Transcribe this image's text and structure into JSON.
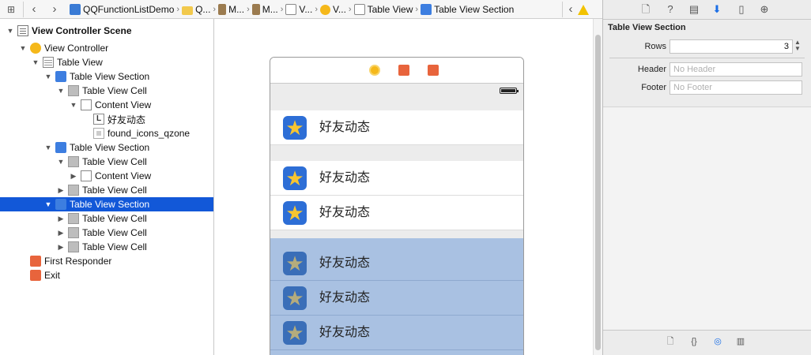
{
  "breadcrumbs": [
    {
      "label": "QQFunctionListDemo",
      "icon": "project-icon"
    },
    {
      "label": "Q...",
      "icon": "folder-icon"
    },
    {
      "label": "M...",
      "icon": "file-icon"
    },
    {
      "label": "M...",
      "icon": "file-icon"
    },
    {
      "label": "V...",
      "icon": "view-controller-scene-icon"
    },
    {
      "label": "V...",
      "icon": "view-controller-icon"
    },
    {
      "label": "Table View",
      "icon": "table-view-icon"
    },
    {
      "label": "Table View Section",
      "icon": "table-view-section-icon"
    }
  ],
  "outline": {
    "items": [
      {
        "label": "View Controller Scene",
        "level": 0,
        "disclosure": "open",
        "icon": "scene-icon",
        "bold": true
      },
      {
        "label": "View Controller",
        "level": 1,
        "disclosure": "open",
        "icon": "view-controller-icon"
      },
      {
        "label": "Table View",
        "level": 2,
        "disclosure": "open",
        "icon": "table-view-icon"
      },
      {
        "label": "Table View Section",
        "level": 3,
        "disclosure": "open",
        "icon": "table-view-section-icon"
      },
      {
        "label": "Table View Cell",
        "level": 4,
        "disclosure": "open",
        "icon": "table-view-cell-icon"
      },
      {
        "label": "Content View",
        "level": 5,
        "disclosure": "open",
        "icon": "content-view-icon"
      },
      {
        "label": "好友动态",
        "level": 6,
        "disclosure": "none",
        "icon": "label-icon"
      },
      {
        "label": "found_icons_qzone",
        "level": 6,
        "disclosure": "none",
        "icon": "image-view-icon"
      },
      {
        "label": "Table View Section",
        "level": 3,
        "disclosure": "open",
        "icon": "table-view-section-icon"
      },
      {
        "label": "Table View Cell",
        "level": 4,
        "disclosure": "open",
        "icon": "table-view-cell-icon"
      },
      {
        "label": "Content View",
        "level": 5,
        "disclosure": "closed",
        "icon": "content-view-icon"
      },
      {
        "label": "Table View Cell",
        "level": 4,
        "disclosure": "closed",
        "icon": "table-view-cell-icon"
      },
      {
        "label": "Table View Section",
        "level": 3,
        "disclosure": "open",
        "icon": "table-view-section-icon",
        "selected": true
      },
      {
        "label": "Table View Cell",
        "level": 4,
        "disclosure": "closed",
        "icon": "table-view-cell-icon"
      },
      {
        "label": "Table View Cell",
        "level": 4,
        "disclosure": "closed",
        "icon": "table-view-cell-icon"
      },
      {
        "label": "Table View Cell",
        "level": 4,
        "disclosure": "closed",
        "icon": "table-view-cell-icon"
      },
      {
        "label": "First Responder",
        "level": 1,
        "disclosure": "none",
        "icon": "first-responder-icon"
      },
      {
        "label": "Exit",
        "level": 1,
        "disclosure": "none",
        "icon": "exit-icon"
      }
    ]
  },
  "canvas": {
    "cells": [
      {
        "label": "好友动态",
        "section": 1,
        "highlighted": false
      },
      {
        "label": "好友动态",
        "section": 2,
        "highlighted": false
      },
      {
        "label": "好友动态",
        "section": 2,
        "highlighted": false
      },
      {
        "label": "好友动态",
        "section": 3,
        "highlighted": true
      },
      {
        "label": "好友动态",
        "section": 3,
        "highlighted": true
      },
      {
        "label": "好友动态",
        "section": 3,
        "highlighted": true
      }
    ]
  },
  "inspector": {
    "title": "Table View Section",
    "rows_label": "Rows",
    "rows_value": "3",
    "header_label": "Header",
    "header_placeholder": "No Header",
    "footer_label": "Footer",
    "footer_placeholder": "No Footer"
  },
  "colors": {
    "selection": "#1258d8",
    "cell_highlight": "#a9c1e2",
    "accent": "#1a6ee6"
  }
}
